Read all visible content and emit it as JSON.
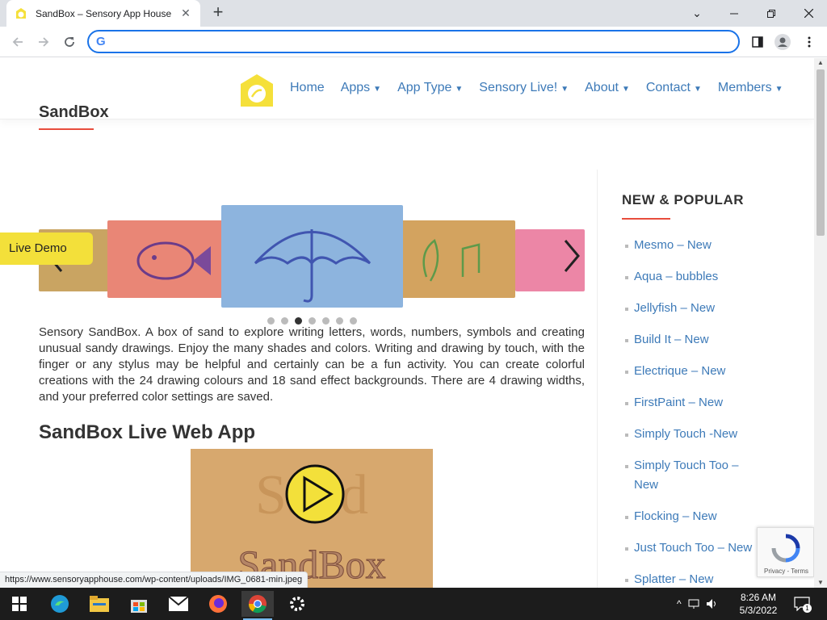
{
  "browser": {
    "tab_title": "SandBox – Sensory App House",
    "tab_close": "✕",
    "new_tab": "+",
    "minimize": "⌄",
    "address_value": "",
    "status_url": "https://www.sensoryapphouse.com/wp-content/uploads/IMG_0681-min.jpeg"
  },
  "nav": {
    "items": [
      {
        "label": "Home",
        "caret": false
      },
      {
        "label": "Apps",
        "caret": true
      },
      {
        "label": "App Type",
        "caret": true
      },
      {
        "label": "Sensory Live!",
        "caret": true
      },
      {
        "label": "About",
        "caret": true
      },
      {
        "label": "Contact",
        "caret": true
      },
      {
        "label": "Members",
        "caret": true
      }
    ]
  },
  "post": {
    "title": "SandBox",
    "live_demo": "Live Demo",
    "description": "Sensory SandBox. A box of sand to explore writing letters, words, numbers, symbols and creating unusual sandy drawings. Enjoy the many shades and colors. Writing and drawing by touch, with the finger or any stylus may be helpful and certainly can be a fun activity. You can create colorful creations with the 24 drawing colours and 18 sand effect backgrounds. There are 4 drawing widths, and your preferred color settings are saved.",
    "subheading": "SandBox Live Web App",
    "video_caption_1": "Sand",
    "video_caption_2": "SandBox"
  },
  "slider": {
    "dot_count": 7,
    "active_index": 2
  },
  "sidebar": {
    "title": "NEW & POPULAR",
    "items": [
      "Mesmo – New",
      "Aqua – bubbles",
      "Jellyfish – New",
      "Build It – New",
      "Electrique – New",
      "FirstPaint – New",
      "Simply Touch -New",
      "Simply Touch Too – New",
      "Flocking – New",
      "Just Touch Too – New",
      "Splatter – New"
    ]
  },
  "recaptcha": {
    "text": "Privacy - Terms"
  },
  "taskbar": {
    "time": "8:26 AM",
    "date": "5/3/2022",
    "notification_count": "1"
  },
  "colors": {
    "link": "#3d7ab8",
    "accent_red": "#e84d3d",
    "live_demo_bg": "#f3e03a",
    "logo_yellow": "#f5e03a"
  }
}
